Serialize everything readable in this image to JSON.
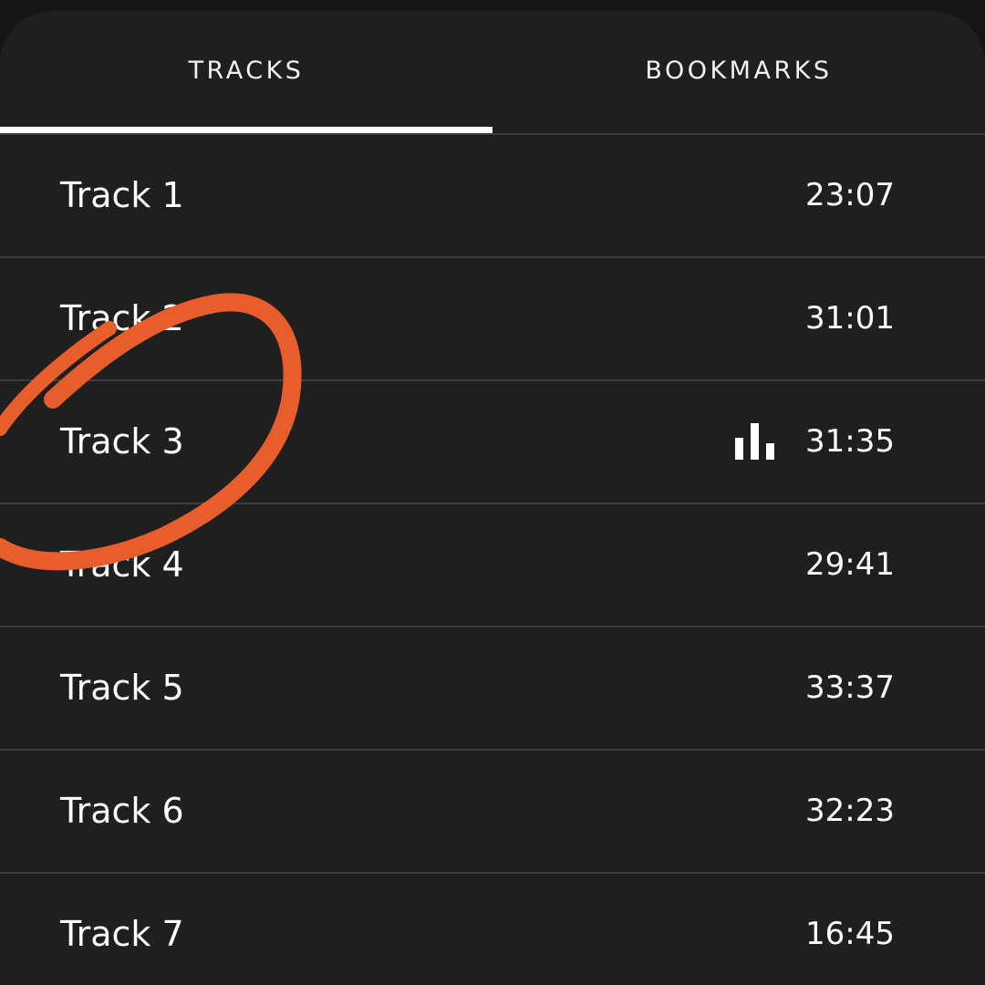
{
  "tabs": [
    {
      "label": "TRACKS",
      "selected": true
    },
    {
      "label": "BOOKMARKS",
      "selected": false
    }
  ],
  "tracks": [
    {
      "name": "Track 1",
      "duration": "23:07",
      "playing": false
    },
    {
      "name": "Track 2",
      "duration": "31:01",
      "playing": false
    },
    {
      "name": "Track 3",
      "duration": "31:35",
      "playing": true
    },
    {
      "name": "Track 4",
      "duration": "29:41",
      "playing": false
    },
    {
      "name": "Track 5",
      "duration": "33:37",
      "playing": false
    },
    {
      "name": "Track 6",
      "duration": "32:23",
      "playing": false
    },
    {
      "name": "Track 7",
      "duration": "16:45",
      "playing": false
    }
  ],
  "icons": {
    "now_playing": "equalizer-bars-icon"
  },
  "colors": {
    "background": "#1f1f1f",
    "text": "#ffffff",
    "divider": "#3d3d3d",
    "annotation": "#e85d2c"
  }
}
